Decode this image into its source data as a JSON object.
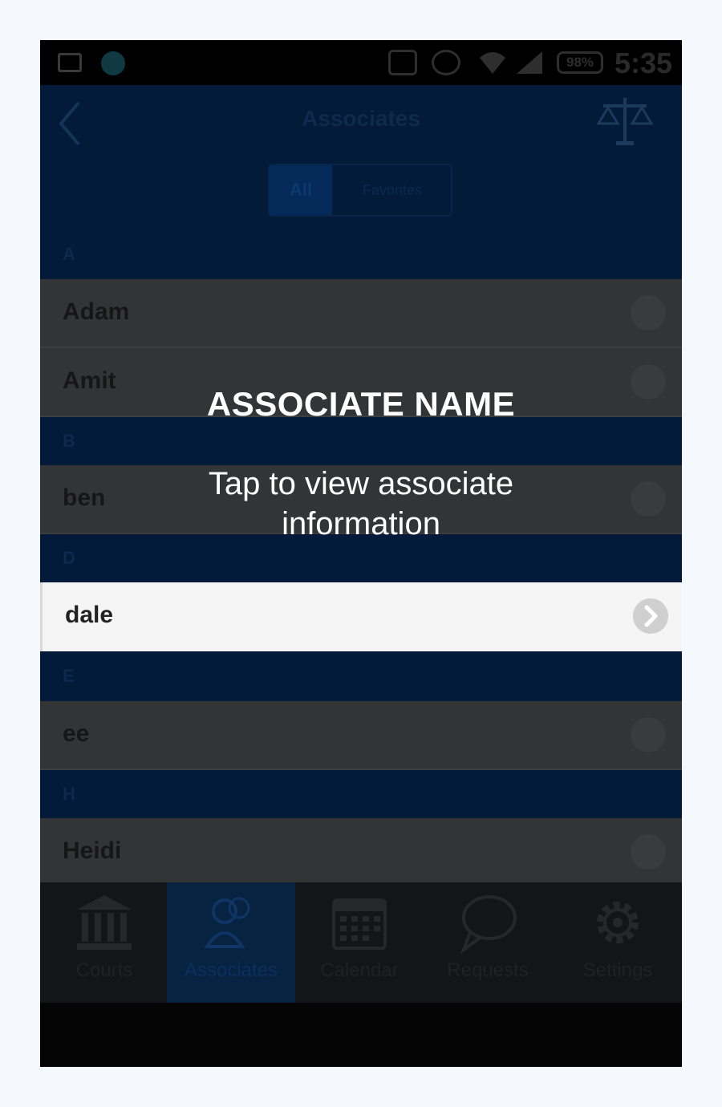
{
  "status_bar": {
    "battery": "98%",
    "time": "5:35"
  },
  "header": {
    "title": "Associates"
  },
  "segments": {
    "all": "All",
    "favorites": "Favorites"
  },
  "list": {
    "sections": [
      "A",
      "B",
      "D",
      "E",
      "H"
    ],
    "rows": [
      "Adam",
      "Amit",
      "ben",
      "dale",
      "ee",
      "Heidi"
    ]
  },
  "tabs": [
    "Courts",
    "Associates",
    "Calendar",
    "Requests",
    "Settings"
  ],
  "overlay": {
    "title": "ASSOCIATE NAME",
    "description": "Tap to view associate information"
  },
  "colors": {
    "header_bg": "#031a39",
    "highlight_row": "#f5f5f5",
    "overlay_text": "#ffffff"
  }
}
